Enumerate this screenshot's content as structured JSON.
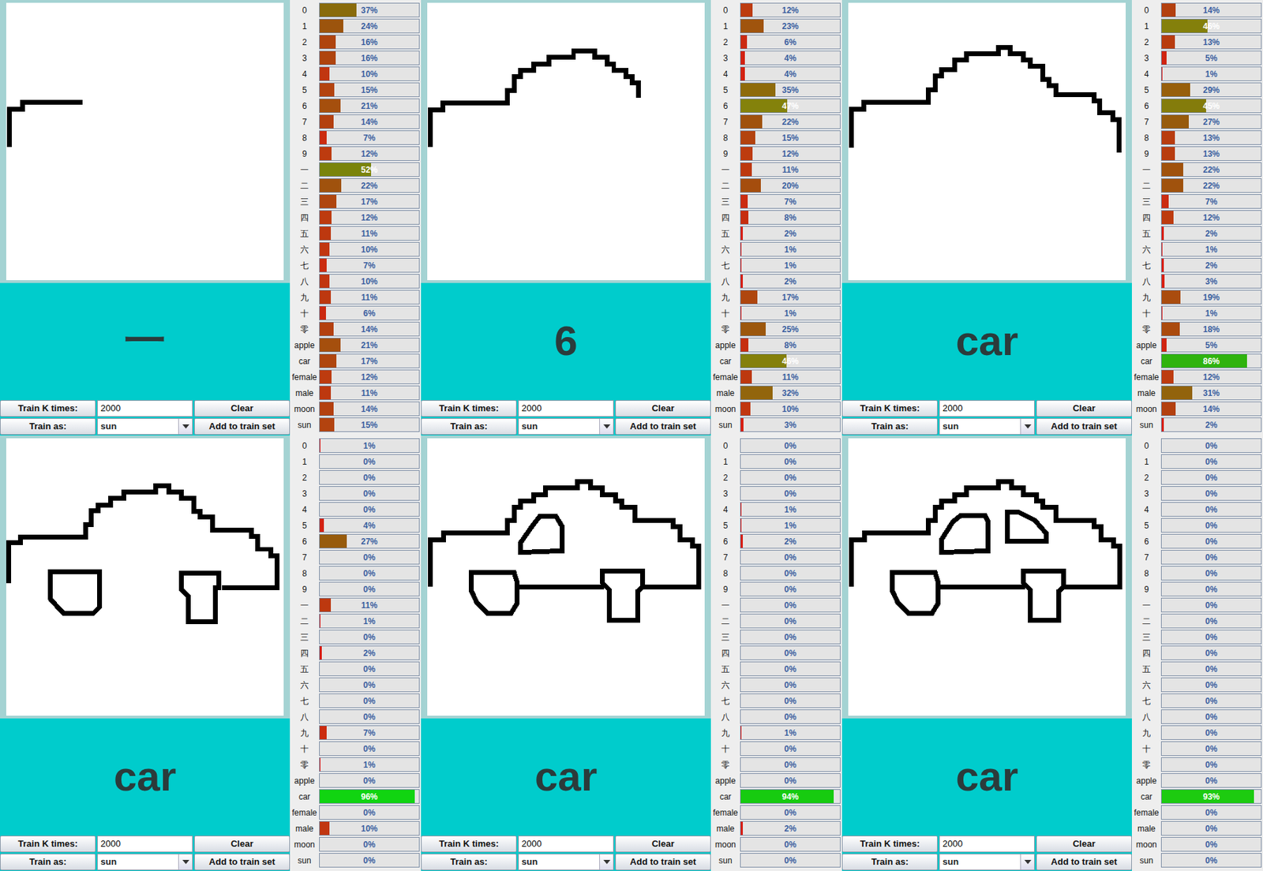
{
  "panels": [
    {
      "label": "一",
      "controls": {
        "train_k_label": "Train K times:",
        "train_k_value": "2000",
        "clear_button": "Clear",
        "train_as_label": "Train as:",
        "train_as_value": "sun",
        "add_button": "Add to train set"
      },
      "bars": [
        {
          "name": "0",
          "reading": "37%",
          "level": 0.37
        },
        {
          "name": "1",
          "reading": "24%",
          "level": 0.24
        },
        {
          "name": "2",
          "reading": "16%",
          "level": 0.16
        },
        {
          "name": "3",
          "reading": "16%",
          "level": 0.16
        },
        {
          "name": "4",
          "reading": "10%",
          "level": 0.1
        },
        {
          "name": "5",
          "reading": "15%",
          "level": 0.15
        },
        {
          "name": "6",
          "reading": "21%",
          "level": 0.21
        },
        {
          "name": "7",
          "reading": "14%",
          "level": 0.14
        },
        {
          "name": "8",
          "reading": "7%",
          "level": 0.07
        },
        {
          "name": "9",
          "reading": "12%",
          "level": 0.12
        },
        {
          "name": "一",
          "reading": "52%",
          "level": 0.52
        },
        {
          "name": "二",
          "reading": "22%",
          "level": 0.22
        },
        {
          "name": "三",
          "reading": "17%",
          "level": 0.17
        },
        {
          "name": "四",
          "reading": "12%",
          "level": 0.12
        },
        {
          "name": "五",
          "reading": "11%",
          "level": 0.11
        },
        {
          "name": "六",
          "reading": "10%",
          "level": 0.1
        },
        {
          "name": "七",
          "reading": "7%",
          "level": 0.07
        },
        {
          "name": "八",
          "reading": "10%",
          "level": 0.1
        },
        {
          "name": "九",
          "reading": "11%",
          "level": 0.11
        },
        {
          "name": "十",
          "reading": "6%",
          "level": 0.06
        },
        {
          "name": "零",
          "reading": "14%",
          "level": 0.14
        },
        {
          "name": "apple",
          "reading": "21%",
          "level": 0.21
        },
        {
          "name": "car",
          "reading": "17%",
          "level": 0.17
        },
        {
          "name": "female",
          "reading": "12%",
          "level": 0.12
        },
        {
          "name": "male",
          "reading": "11%",
          "level": 0.11
        },
        {
          "name": "moon",
          "reading": "14%",
          "level": 0.14
        },
        {
          "name": "sun",
          "reading": "15%",
          "level": 0.15
        }
      ]
    },
    {
      "label": "6",
      "controls": {
        "train_k_label": "Train K times:",
        "train_k_value": "2000",
        "clear_button": "Clear",
        "train_as_label": "Train as:",
        "train_as_value": "sun",
        "add_button": "Add to train set"
      },
      "bars": [
        {
          "name": "0",
          "reading": "12%",
          "level": 0.12
        },
        {
          "name": "1",
          "reading": "23%",
          "level": 0.23
        },
        {
          "name": "2",
          "reading": "6%",
          "level": 0.06
        },
        {
          "name": "3",
          "reading": "4%",
          "level": 0.04
        },
        {
          "name": "4",
          "reading": "4%",
          "level": 0.04
        },
        {
          "name": "5",
          "reading": "35%",
          "level": 0.35
        },
        {
          "name": "6",
          "reading": "47%",
          "level": 0.47
        },
        {
          "name": "7",
          "reading": "22%",
          "level": 0.22
        },
        {
          "name": "8",
          "reading": "15%",
          "level": 0.15
        },
        {
          "name": "9",
          "reading": "12%",
          "level": 0.12
        },
        {
          "name": "一",
          "reading": "11%",
          "level": 0.11
        },
        {
          "name": "二",
          "reading": "20%",
          "level": 0.2
        },
        {
          "name": "三",
          "reading": "7%",
          "level": 0.07
        },
        {
          "name": "四",
          "reading": "8%",
          "level": 0.08
        },
        {
          "name": "五",
          "reading": "2%",
          "level": 0.02
        },
        {
          "name": "六",
          "reading": "1%",
          "level": 0.01
        },
        {
          "name": "七",
          "reading": "1%",
          "level": 0.01
        },
        {
          "name": "八",
          "reading": "2%",
          "level": 0.02
        },
        {
          "name": "九",
          "reading": "17%",
          "level": 0.17
        },
        {
          "name": "十",
          "reading": "1%",
          "level": 0.01
        },
        {
          "name": "零",
          "reading": "25%",
          "level": 0.25
        },
        {
          "name": "apple",
          "reading": "8%",
          "level": 0.08
        },
        {
          "name": "car",
          "reading": "46%",
          "level": 0.46
        },
        {
          "name": "female",
          "reading": "11%",
          "level": 0.11
        },
        {
          "name": "male",
          "reading": "32%",
          "level": 0.32
        },
        {
          "name": "moon",
          "reading": "10%",
          "level": 0.1
        },
        {
          "name": "sun",
          "reading": "3%",
          "level": 0.03
        }
      ]
    },
    {
      "label": "car",
      "controls": {
        "train_k_label": "Train K times:",
        "train_k_value": "2000",
        "clear_button": "Clear",
        "train_as_label": "Train as:",
        "train_as_value": "sun",
        "add_button": "Add to train set"
      },
      "bars": [
        {
          "name": "0",
          "reading": "14%",
          "level": 0.14
        },
        {
          "name": "1",
          "reading": "46%",
          "level": 0.46
        },
        {
          "name": "2",
          "reading": "13%",
          "level": 0.13
        },
        {
          "name": "3",
          "reading": "5%",
          "level": 0.05
        },
        {
          "name": "4",
          "reading": "1%",
          "level": 0.01
        },
        {
          "name": "5",
          "reading": "29%",
          "level": 0.29
        },
        {
          "name": "6",
          "reading": "45%",
          "level": 0.45
        },
        {
          "name": "7",
          "reading": "27%",
          "level": 0.27
        },
        {
          "name": "8",
          "reading": "13%",
          "level": 0.13
        },
        {
          "name": "9",
          "reading": "13%",
          "level": 0.13
        },
        {
          "name": "一",
          "reading": "22%",
          "level": 0.22
        },
        {
          "name": "二",
          "reading": "22%",
          "level": 0.22
        },
        {
          "name": "三",
          "reading": "7%",
          "level": 0.07
        },
        {
          "name": "四",
          "reading": "12%",
          "level": 0.12
        },
        {
          "name": "五",
          "reading": "2%",
          "level": 0.02
        },
        {
          "name": "六",
          "reading": "1%",
          "level": 0.01
        },
        {
          "name": "七",
          "reading": "2%",
          "level": 0.02
        },
        {
          "name": "八",
          "reading": "3%",
          "level": 0.03
        },
        {
          "name": "九",
          "reading": "19%",
          "level": 0.19
        },
        {
          "name": "十",
          "reading": "1%",
          "level": 0.01
        },
        {
          "name": "零",
          "reading": "18%",
          "level": 0.18
        },
        {
          "name": "apple",
          "reading": "5%",
          "level": 0.05
        },
        {
          "name": "car",
          "reading": "86%",
          "level": 0.86
        },
        {
          "name": "female",
          "reading": "12%",
          "level": 0.12
        },
        {
          "name": "male",
          "reading": "31%",
          "level": 0.31
        },
        {
          "name": "moon",
          "reading": "14%",
          "level": 0.14
        },
        {
          "name": "sun",
          "reading": "2%",
          "level": 0.02
        }
      ]
    },
    {
      "label": "car",
      "controls": {
        "train_k_label": "Train K times:",
        "train_k_value": "2000",
        "clear_button": "Clear",
        "train_as_label": "Train as:",
        "train_as_value": "sun",
        "add_button": "Add to train set"
      },
      "bars": [
        {
          "name": "0",
          "reading": "1%",
          "level": 0.01
        },
        {
          "name": "1",
          "reading": "0%",
          "level": 0
        },
        {
          "name": "2",
          "reading": "0%",
          "level": 0
        },
        {
          "name": "3",
          "reading": "0%",
          "level": 0
        },
        {
          "name": "4",
          "reading": "0%",
          "level": 0
        },
        {
          "name": "5",
          "reading": "4%",
          "level": 0.04
        },
        {
          "name": "6",
          "reading": "27%",
          "level": 0.27
        },
        {
          "name": "7",
          "reading": "0%",
          "level": 0
        },
        {
          "name": "8",
          "reading": "0%",
          "level": 0
        },
        {
          "name": "9",
          "reading": "0%",
          "level": 0
        },
        {
          "name": "一",
          "reading": "11%",
          "level": 0.11
        },
        {
          "name": "二",
          "reading": "1%",
          "level": 0.01
        },
        {
          "name": "三",
          "reading": "0%",
          "level": 0
        },
        {
          "name": "四",
          "reading": "2%",
          "level": 0.02
        },
        {
          "name": "五",
          "reading": "0%",
          "level": 0
        },
        {
          "name": "六",
          "reading": "0%",
          "level": 0
        },
        {
          "name": "七",
          "reading": "0%",
          "level": 0
        },
        {
          "name": "八",
          "reading": "0%",
          "level": 0
        },
        {
          "name": "九",
          "reading": "7%",
          "level": 0.07
        },
        {
          "name": "十",
          "reading": "0%",
          "level": 0
        },
        {
          "name": "零",
          "reading": "1%",
          "level": 0.01
        },
        {
          "name": "apple",
          "reading": "0%",
          "level": 0
        },
        {
          "name": "car",
          "reading": "96%",
          "level": 0.96
        },
        {
          "name": "female",
          "reading": "0%",
          "level": 0
        },
        {
          "name": "male",
          "reading": "10%",
          "level": 0.1
        },
        {
          "name": "moon",
          "reading": "0%",
          "level": 0
        },
        {
          "name": "sun",
          "reading": "0%",
          "level": 0
        }
      ]
    },
    {
      "label": "car",
      "controls": {
        "train_k_label": "Train K times:",
        "train_k_value": "2000",
        "clear_button": "Clear",
        "train_as_label": "Train as:",
        "train_as_value": "sun",
        "add_button": "Add to train set"
      },
      "bars": [
        {
          "name": "0",
          "reading": "0%",
          "level": 0
        },
        {
          "name": "1",
          "reading": "0%",
          "level": 0
        },
        {
          "name": "2",
          "reading": "0%",
          "level": 0
        },
        {
          "name": "3",
          "reading": "0%",
          "level": 0
        },
        {
          "name": "4",
          "reading": "1%",
          "level": 0.01
        },
        {
          "name": "5",
          "reading": "1%",
          "level": 0.01
        },
        {
          "name": "6",
          "reading": "2%",
          "level": 0.02
        },
        {
          "name": "7",
          "reading": "0%",
          "level": 0
        },
        {
          "name": "8",
          "reading": "0%",
          "level": 0
        },
        {
          "name": "9",
          "reading": "0%",
          "level": 0
        },
        {
          "name": "一",
          "reading": "0%",
          "level": 0
        },
        {
          "name": "二",
          "reading": "0%",
          "level": 0
        },
        {
          "name": "三",
          "reading": "0%",
          "level": 0
        },
        {
          "name": "四",
          "reading": "0%",
          "level": 0
        },
        {
          "name": "五",
          "reading": "0%",
          "level": 0
        },
        {
          "name": "六",
          "reading": "0%",
          "level": 0
        },
        {
          "name": "七",
          "reading": "0%",
          "level": 0
        },
        {
          "name": "八",
          "reading": "0%",
          "level": 0
        },
        {
          "name": "九",
          "reading": "1%",
          "level": 0.01
        },
        {
          "name": "十",
          "reading": "0%",
          "level": 0
        },
        {
          "name": "零",
          "reading": "0%",
          "level": 0
        },
        {
          "name": "apple",
          "reading": "0%",
          "level": 0
        },
        {
          "name": "car",
          "reading": "94%",
          "level": 0.94
        },
        {
          "name": "female",
          "reading": "0%",
          "level": 0
        },
        {
          "name": "male",
          "reading": "2%",
          "level": 0.02
        },
        {
          "name": "moon",
          "reading": "0%",
          "level": 0
        },
        {
          "name": "sun",
          "reading": "0%",
          "level": 0
        }
      ]
    },
    {
      "label": "car",
      "controls": {
        "train_k_label": "Train K times:",
        "train_k_value": "2000",
        "clear_button": "Clear",
        "train_as_label": "Train as:",
        "train_as_value": "sun",
        "add_button": "Add to train set"
      },
      "bars": [
        {
          "name": "0",
          "reading": "0%",
          "level": 0
        },
        {
          "name": "1",
          "reading": "0%",
          "level": 0
        },
        {
          "name": "2",
          "reading": "0%",
          "level": 0
        },
        {
          "name": "3",
          "reading": "0%",
          "level": 0
        },
        {
          "name": "4",
          "reading": "0%",
          "level": 0
        },
        {
          "name": "5",
          "reading": "0%",
          "level": 0
        },
        {
          "name": "6",
          "reading": "0%",
          "level": 0
        },
        {
          "name": "7",
          "reading": "0%",
          "level": 0
        },
        {
          "name": "8",
          "reading": "0%",
          "level": 0
        },
        {
          "name": "9",
          "reading": "0%",
          "level": 0
        },
        {
          "name": "一",
          "reading": "0%",
          "level": 0
        },
        {
          "name": "二",
          "reading": "0%",
          "level": 0
        },
        {
          "name": "三",
          "reading": "0%",
          "level": 0
        },
        {
          "name": "四",
          "reading": "0%",
          "level": 0
        },
        {
          "name": "五",
          "reading": "0%",
          "level": 0
        },
        {
          "name": "六",
          "reading": "0%",
          "level": 0
        },
        {
          "name": "七",
          "reading": "0%",
          "level": 0
        },
        {
          "name": "八",
          "reading": "0%",
          "level": 0
        },
        {
          "name": "九",
          "reading": "0%",
          "level": 0
        },
        {
          "name": "十",
          "reading": "0%",
          "level": 0
        },
        {
          "name": "零",
          "reading": "0%",
          "level": 0
        },
        {
          "name": "apple",
          "reading": "0%",
          "level": 0
        },
        {
          "name": "car",
          "reading": "93%",
          "level": 0.93
        },
        {
          "name": "female",
          "reading": "0%",
          "level": 0
        },
        {
          "name": "male",
          "reading": "0%",
          "level": 0
        },
        {
          "name": "moon",
          "reading": "0%",
          "level": 0
        },
        {
          "name": "sun",
          "reading": "0%",
          "level": 0
        }
      ]
    }
  ]
}
